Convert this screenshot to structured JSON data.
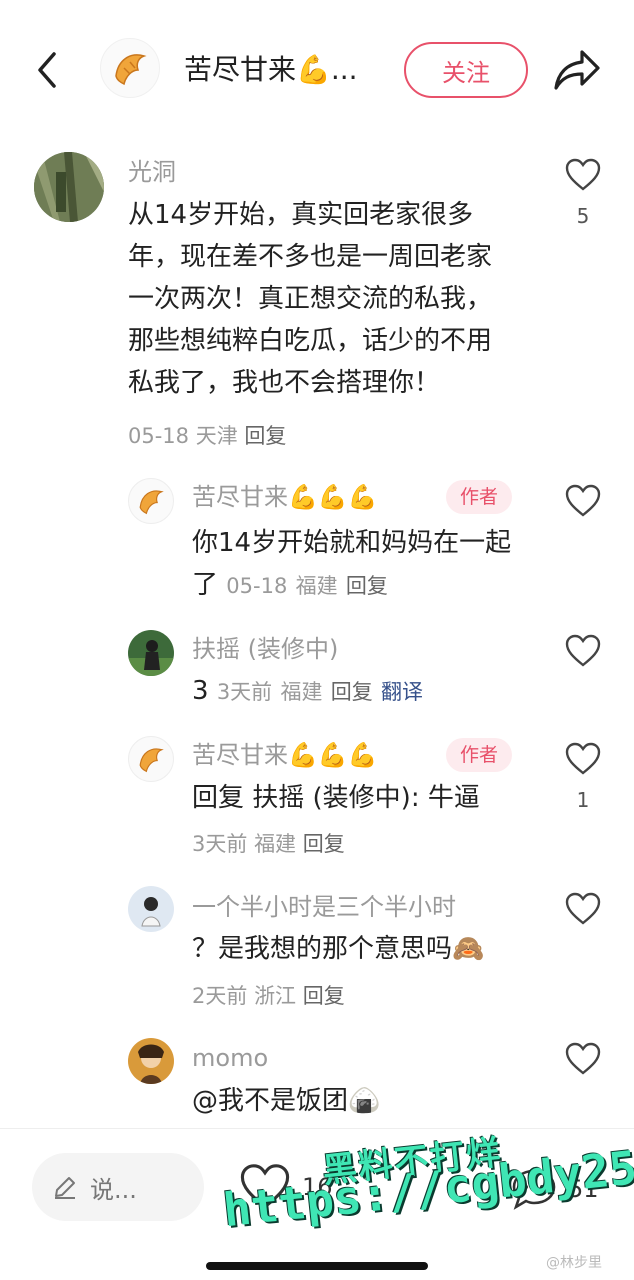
{
  "header": {
    "title": "苦尽甘来💪...",
    "follow_label": "关注"
  },
  "comments": [
    {
      "username": "光洞",
      "text": "从14岁开始，真实回老家很多年，现在差不多也是一周回老家一次两次！真正想交流的私我，那些想纯粹白吃瓜，话少的不用私我了，我也不会搭理你！",
      "date": "05-18",
      "location": "天津",
      "reply_label": "回复",
      "likes": "5"
    },
    {
      "username": "苦尽甘来💪💪💪",
      "badge": "作者",
      "text": "你14岁开始就和妈妈在一起了",
      "date": "05-18",
      "location": "福建",
      "reply_label": "回复",
      "likes": ""
    },
    {
      "username": "扶摇 (装修中)",
      "text": "3",
      "date": "3天前",
      "location": "福建",
      "reply_label": "回复",
      "translate_label": "翻译",
      "likes": ""
    },
    {
      "username": "苦尽甘来💪💪💪",
      "badge": "作者",
      "text": "回复 扶摇 (装修中): 牛逼",
      "date": "3天前",
      "location": "福建",
      "reply_label": "回复",
      "likes": "1"
    },
    {
      "username": "一个半小时是三个半小时",
      "text": "？是我想的那个意思吗🙈",
      "date": "2天前",
      "location": "浙江",
      "reply_label": "回复",
      "likes": ""
    },
    {
      "username": "momo",
      "text": "@我不是饭团🍙",
      "likes": ""
    }
  ],
  "bottom_bar": {
    "input_placeholder": "说...",
    "likes_count": "16",
    "comments_count": "51"
  },
  "watermark": {
    "line1": "黑料不打烊",
    "line2": "https://cgbdy25.com",
    "credit": "@林步里"
  },
  "colors": {
    "accent": "#e8516a",
    "muted_text": "#9a9a9a",
    "translate_link": "#35508a",
    "watermark": "#3fe6b4"
  },
  "icons": [
    "back-arrow-icon",
    "croissant-icon",
    "share-icon",
    "heart-icon",
    "pencil-icon",
    "chat-bubble-icon",
    "flexed-biceps-emoji",
    "monkey-emoji",
    "rice-ball-emoji"
  ]
}
